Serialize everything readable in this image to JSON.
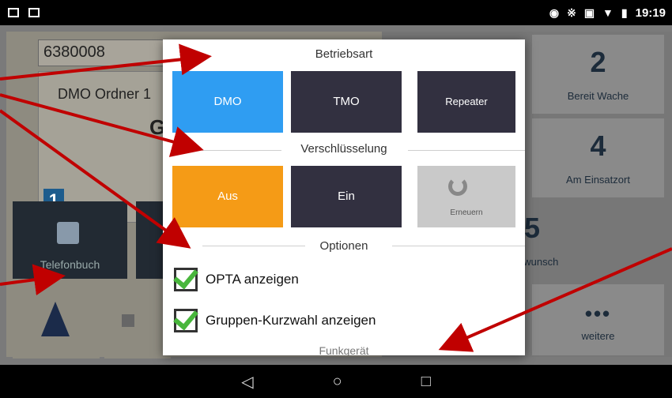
{
  "status_bar": {
    "time": "19:19",
    "icons": [
      "app-icon-1",
      "app-icon-2",
      "location-icon",
      "bluetooth-icon",
      "car-icon",
      "wifi-icon",
      "battery-icon"
    ]
  },
  "background": {
    "id_field": "6380008",
    "dmo_card_title": "DMO Ordner 1",
    "dmo_card_letter": "Gr",
    "badge_number": "1",
    "telefonbuch_label": "Telefonbuch",
    "status_tiles": [
      {
        "number": "2",
        "label": "Bereit Wache"
      },
      {
        "number": "4",
        "label": "Am Einsatzort"
      },
      {
        "number": "5",
        "label": "hwunsch"
      },
      {
        "number": "•••",
        "label": "weitere"
      }
    ]
  },
  "dialog": {
    "betriebsart": {
      "title": "Betriebsart",
      "buttons": [
        "DMO",
        "TMO",
        "Repeater"
      ],
      "selected": "DMO"
    },
    "verschluesselung": {
      "title": "Verschlüsselung",
      "buttons": [
        "Aus",
        "Ein"
      ],
      "selected": "Aus",
      "renew_label": "Erneuern"
    },
    "optionen": {
      "title": "Optionen",
      "items": [
        {
          "label": "OPTA anzeigen",
          "checked": true
        },
        {
          "label": "Gruppen-Kurzwahl anzeigen",
          "checked": true
        }
      ]
    },
    "next_section_partial": "Funkgerät"
  },
  "colors": {
    "selected_blue": "#2f9df2",
    "selected_orange": "#f59b16",
    "dark_button": "#323040",
    "check_green": "#48b63c",
    "annotation_red": "#c00000"
  }
}
